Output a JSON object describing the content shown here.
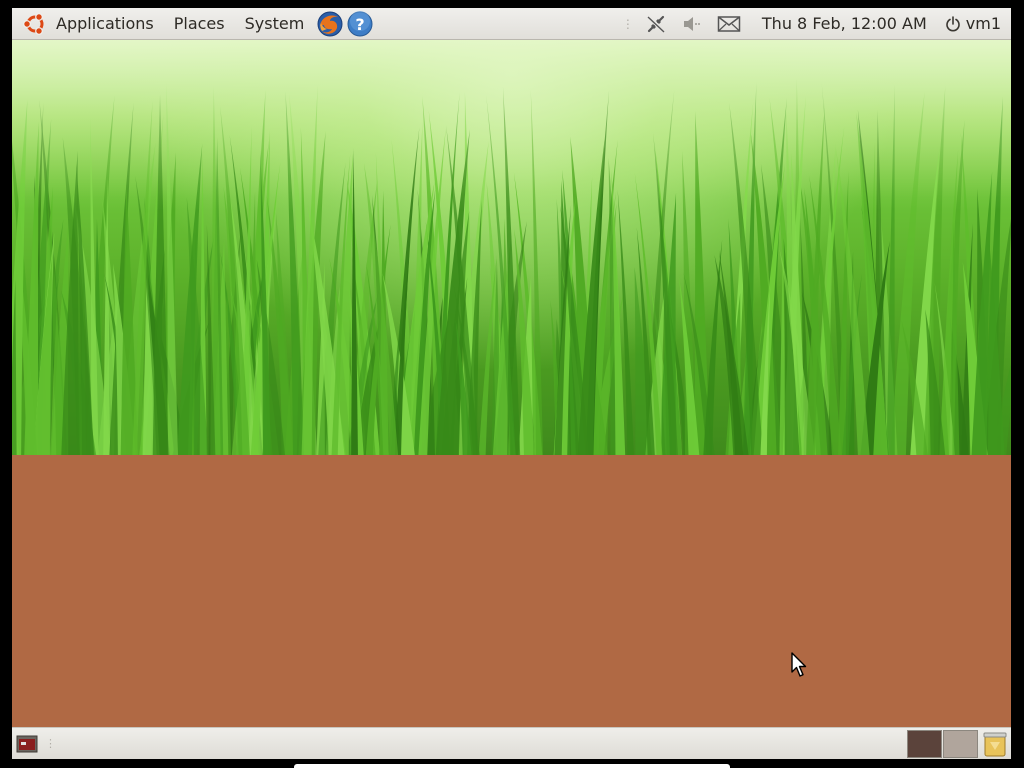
{
  "top_panel": {
    "menus": {
      "applications": "Applications",
      "places": "Places",
      "system": "System"
    },
    "launchers": [
      "firefox-icon",
      "help-icon"
    ],
    "tray_icons": [
      "network-icon",
      "volume-icon",
      "mail-icon"
    ],
    "clock": "Thu  8 Feb, 12:00 AM",
    "session_user": "vm1"
  },
  "desktop": {
    "wallpaper_top": "grass",
    "wallpaper_bottom_color": "#b06944"
  },
  "bottom_panel": {
    "icons": [
      "show-desktop-icon",
      "trash-icon"
    ],
    "workspace_colors": [
      "#5b433b",
      "#b0a59c"
    ]
  },
  "colors": {
    "panel": "#e6e4df",
    "text": "#2d2a25",
    "ubuntu_orange": "#dd4814",
    "grass_green": "#6cc238"
  }
}
